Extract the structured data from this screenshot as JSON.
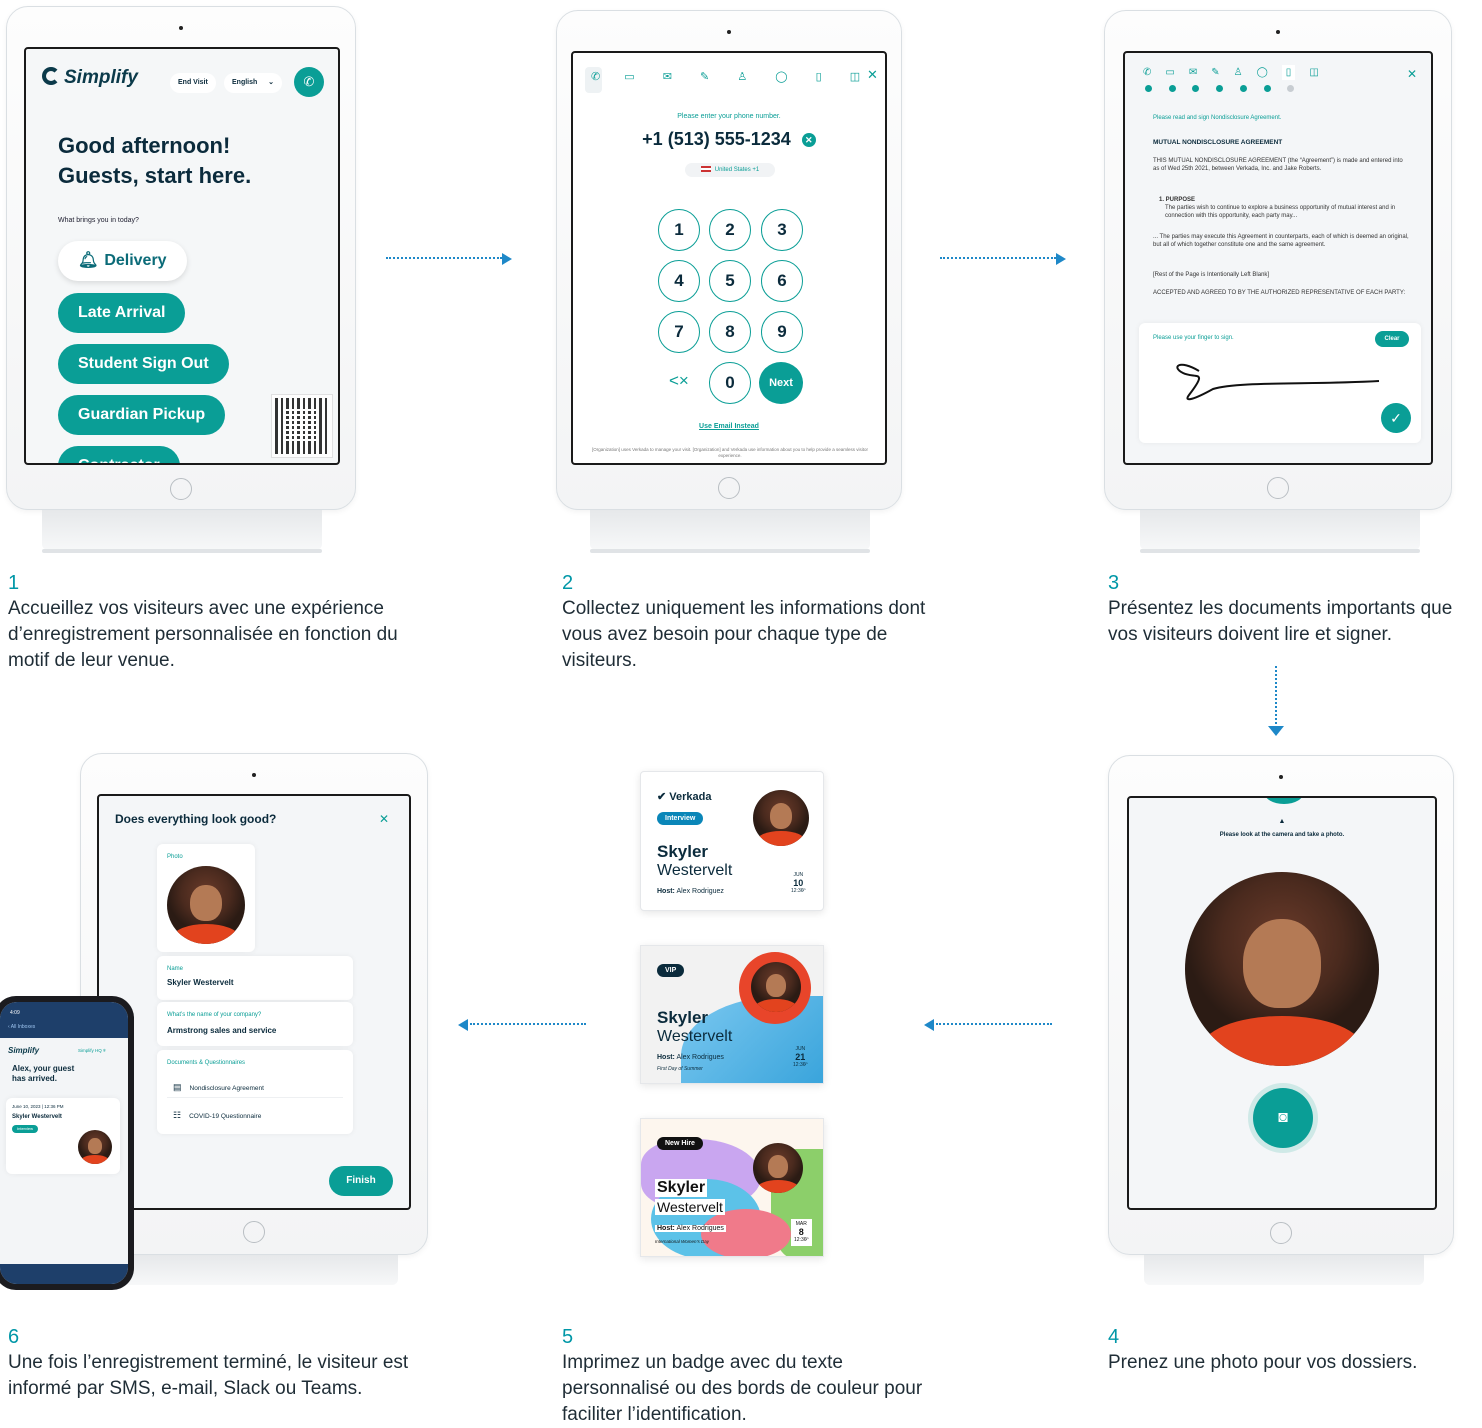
{
  "step1": {
    "brand": "Simplify",
    "end_visit": "End Visit",
    "language": "English",
    "greeting_line1": "Good afternoon!",
    "greeting_line2": "Guests, start here.",
    "question": "What brings you in today?",
    "options": [
      "Delivery",
      "Late Arrival",
      "Student Sign Out",
      "Guardian Pickup",
      "Contractor"
    ],
    "number": "1",
    "caption": "Accueillez vos visiteurs avec une expérience d’enregistrement personnalisée en fonction du motif de leur venue."
  },
  "step2": {
    "prompt": "Please enter your phone number.",
    "phone": "+1 (513) 555-1234",
    "country": "United States +1",
    "keys": [
      "1",
      "2",
      "3",
      "4",
      "5",
      "6",
      "7",
      "8",
      "9",
      "0"
    ],
    "next": "Next",
    "use_email": "Use Email Instead",
    "footer": "[Organization] uses Verkada to manage your visit. [Organization] and Verkada use information about you to help provide a seamless visitor experience.",
    "number": "2",
    "caption": "Collectez uniquement les informations dont vous avez besoin pour chaque type de visiteurs."
  },
  "step3": {
    "prompt": "Please read and sign Nondisclosure Agreement.",
    "doc_title": "MUTUAL NONDISCLOSURE AGREEMENT",
    "para1": "THIS MUTUAL NONDISCLOSURE AGREEMENT (the “Agreement”) is made and entered into as of Wed 25th 2021, between Verkada, Inc. and Jake Roberts.",
    "purpose_head": "1. PURPOSE",
    "purpose": "The parties wish to continue to explore a business opportunity of mutual interest and in connection with this opportunity, each party may...",
    "para2": "... The parties may execute this Agreement in counterparts, each of which is deemed an original, but all of which together constitute one and the same agreement.",
    "para3": "[Rest of the Page is Intentionally Left Blank]",
    "para4": "ACCEPTED AND AGREED TO BY THE AUTHORIZED REPRESENTATIVE OF EACH PARTY:",
    "sign_prompt": "Please use your finger to sign.",
    "clear": "Clear",
    "number": "3",
    "caption": "Présentez les documents importants que vos visiteurs doivent lire et signer."
  },
  "step4": {
    "prompt": "Please look at the camera and take a photo.",
    "number": "4",
    "caption": "Prenez une photo pour vos dossiers."
  },
  "step5": {
    "badge1": {
      "brand": "Verkada",
      "tag": "Interview",
      "first": "Skyler",
      "last": "Westervelt",
      "host_label": "Host:",
      "host": "Alex Rodriguez",
      "month": "JUN",
      "day": "10",
      "time": "12:36ᴾ"
    },
    "badge2": {
      "tag": "VIP",
      "first": "Skyler",
      "last": "Westervelt",
      "host_label": "Host:",
      "host": "Alex Rodrigues",
      "event": "First Day of Summer",
      "month": "JUN",
      "day": "21",
      "time": "12:36ᴾ"
    },
    "badge3": {
      "tag": "New Hire",
      "first": "Skyler",
      "last": "Westervelt",
      "host_label": "Host:",
      "host": "Alex Rodrigues",
      "event": "International Women’s Day",
      "month": "MAR",
      "day": "8",
      "time": "12:36ᴾ"
    },
    "number": "5",
    "caption": "Imprimez un badge avec du texte personnalisé ou des bords de couleur pour faciliter l’identification."
  },
  "step6": {
    "title": "Does everything look good?",
    "photo_label": "Photo",
    "name_label": "Name",
    "name": "Skyler Westervelt",
    "company_label": "What’s the name of your company?",
    "company": "Armstrong sales and service",
    "docs_label": "Documents & Questionnaires",
    "doc1": "Nondisclosure Agreement",
    "doc2": "COVID-19 Questionnaire",
    "finish": "Finish",
    "phone": {
      "time": "4:09",
      "back": "All Inboxes",
      "brand": "Simplify",
      "location": "Simplify HQ",
      "message_line1": "Alex, your guest",
      "message_line2": "has arrived.",
      "date": "June 10, 2023",
      "clock": "12:36 PM",
      "guest": "Skyler Westervelt",
      "tag": "Interview"
    },
    "number": "6",
    "caption": "Une fois l’enregistrement terminé, le visiteur est informé par SMS, e-mail, Slack ou Teams."
  },
  "colors": {
    "teal": "#0a9e96",
    "arrow": "#1e88c8",
    "step_number": "#0097a7"
  }
}
